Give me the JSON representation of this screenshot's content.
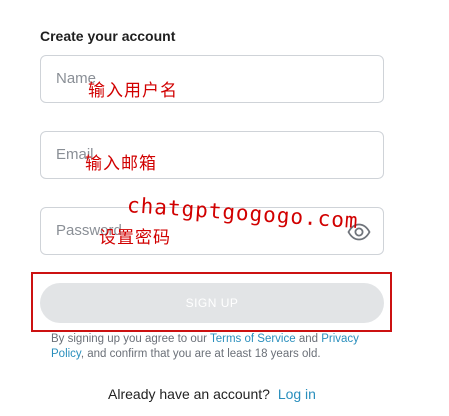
{
  "form": {
    "title": "Create your account",
    "name_placeholder": "Name",
    "name_overlay": "输入用户名",
    "email_placeholder": "Email",
    "email_overlay": "输入邮箱",
    "password_placeholder": "Password",
    "password_overlay": "设置密码",
    "eye_icon": "eye-icon",
    "watermark": "chatgptgogogo.com",
    "signup_label": "SIGN UP"
  },
  "terms": {
    "prefix": "By signing up you agree to our",
    "terms_link": "Terms of Service",
    "and": "and",
    "privacy_link": "Privacy Policy",
    "suffix": ", and confirm that you are at least 18 years old."
  },
  "footer": {
    "prompt": "Already have an account?",
    "login_link": "Log in"
  },
  "colors": {
    "annotation_red": "#d10000",
    "link_blue": "#2a8fbd",
    "button_disabled": "#e2e4e6"
  }
}
